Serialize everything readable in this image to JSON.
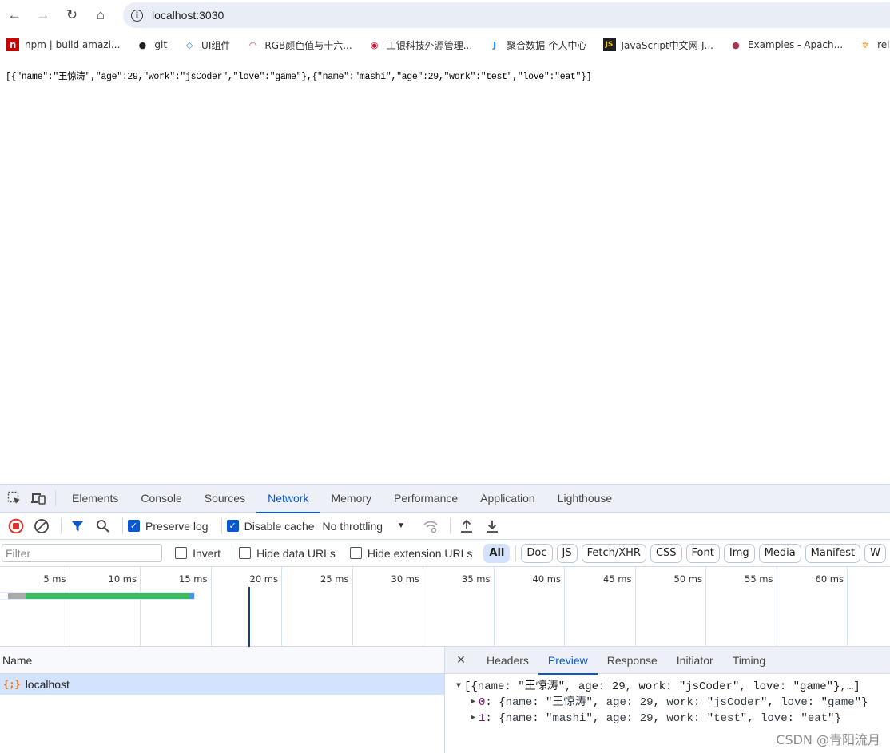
{
  "browser": {
    "url": "localhost:3030",
    "nav": {
      "back": "←",
      "forward": "→",
      "reload": "↻",
      "home": "⌂"
    },
    "bookmarks": [
      {
        "label": "npm | build amazi...",
        "icon": "npm-icon",
        "glyph": "n",
        "color": "#cb0000"
      },
      {
        "label": "git",
        "icon": "github-icon",
        "glyph": "●",
        "color": "#1f1f1f"
      },
      {
        "label": "UI组件",
        "icon": "diamond-icon",
        "glyph": "◇",
        "color": "#2f8cff"
      },
      {
        "label": "RGB颜色值与十六...",
        "icon": "rainbow-icon",
        "glyph": "◠",
        "color": "#e84c3d"
      },
      {
        "label": "工银科技外源管理...",
        "icon": "icbc-icon",
        "glyph": "◉",
        "color": "#c8102e"
      },
      {
        "label": "聚合数据-个人中心",
        "icon": "juhe-icon",
        "glyph": "J",
        "color": "#1e88e5"
      },
      {
        "label": "JavaScript中文网-J...",
        "icon": "js-icon",
        "glyph": "JS",
        "color": "#f0c419"
      },
      {
        "label": "Examples - Apach...",
        "icon": "echarts-icon",
        "glyph": "●",
        "color": "#aa344d"
      },
      {
        "label": "relation",
        "icon": "relation-icon",
        "glyph": "✲",
        "color": "#f7931e"
      }
    ]
  },
  "page": {
    "body_text": "[{\"name\":\"王惊涛\",\"age\":29,\"work\":\"jsCoder\",\"love\":\"game\"},{\"name\":\"mashi\",\"age\":29,\"work\":\"test\",\"love\":\"eat\"}]"
  },
  "devtools": {
    "tabs": [
      "Elements",
      "Console",
      "Sources",
      "Network",
      "Memory",
      "Performance",
      "Application",
      "Lighthouse"
    ],
    "active_tab": "Network",
    "toolbar": {
      "preserve_log": {
        "label": "Preserve log",
        "checked": true
      },
      "disable_cache": {
        "label": "Disable cache",
        "checked": true
      },
      "throttling": "No throttling"
    },
    "filter": {
      "placeholder": "Filter",
      "invert": {
        "label": "Invert",
        "checked": false
      },
      "hide_data_urls": {
        "label": "Hide data URLs",
        "checked": false
      },
      "hide_extension_urls": {
        "label": "Hide extension URLs",
        "checked": false
      },
      "types": [
        "All",
        "Doc",
        "JS",
        "Fetch/XHR",
        "CSS",
        "Font",
        "Img",
        "Media",
        "Manifest",
        "W"
      ],
      "active_type": "All"
    },
    "timeline": {
      "ticks": [
        "5 ms",
        "10 ms",
        "15 ms",
        "20 ms",
        "25 ms",
        "30 ms",
        "35 ms",
        "40 ms",
        "45 ms",
        "50 ms",
        "55 ms",
        "60 ms"
      ],
      "request_ms": {
        "queue_start": 0.7,
        "waiting_start": 1.1,
        "download_start": 1.9,
        "download_end": 13.5
      },
      "dom_content_loaded_ms": 17.7,
      "load_ms": 17.9
    },
    "requests": {
      "column": "Name",
      "rows": [
        {
          "name": "localhost",
          "type": "fetch"
        }
      ]
    },
    "details": {
      "close": "×",
      "tabs": [
        "Headers",
        "Preview",
        "Response",
        "Initiator",
        "Timing"
      ],
      "active_tab": "Preview",
      "preview": {
        "summary": "[{name: \"王惊涛\", age: 29, work: \"jsCoder\", love: \"game\"},…]",
        "items": [
          {
            "index": "0",
            "name": "王惊涛",
            "age": "29",
            "work": "jsCoder",
            "love": "game"
          },
          {
            "index": "1",
            "name": "mashi",
            "age": "29",
            "work": "test",
            "love": "eat"
          }
        ]
      }
    }
  },
  "watermark": "CSDN @青阳流月"
}
